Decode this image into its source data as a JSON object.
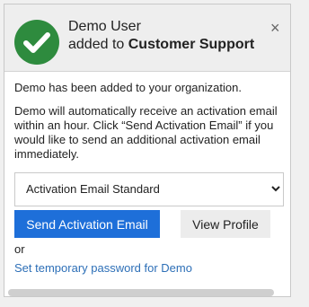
{
  "header": {
    "user_name": "Demo User",
    "added_to": "added to",
    "group": "Customer Support",
    "close_glyph": "×"
  },
  "message": {
    "line1": "Demo has been added to your organization.",
    "line2": "Demo will automatically receive an activation email within an hour. Click “Send Activation Email” if you would like to send an additional activation email immediately."
  },
  "select": {
    "value": "Activation Email Standard"
  },
  "buttons": {
    "send_activation": "Send Activation Email",
    "view_profile": "View Profile"
  },
  "or_label": "or",
  "temp_password_link": "Set temporary password for Demo",
  "colors": {
    "success": "#2e8b3e",
    "primary": "#1e6fd9",
    "link": "#2d6fb7"
  },
  "icons": {
    "success": "check-circle-icon",
    "close": "close-icon",
    "dropdown": "chevron-down-icon"
  }
}
